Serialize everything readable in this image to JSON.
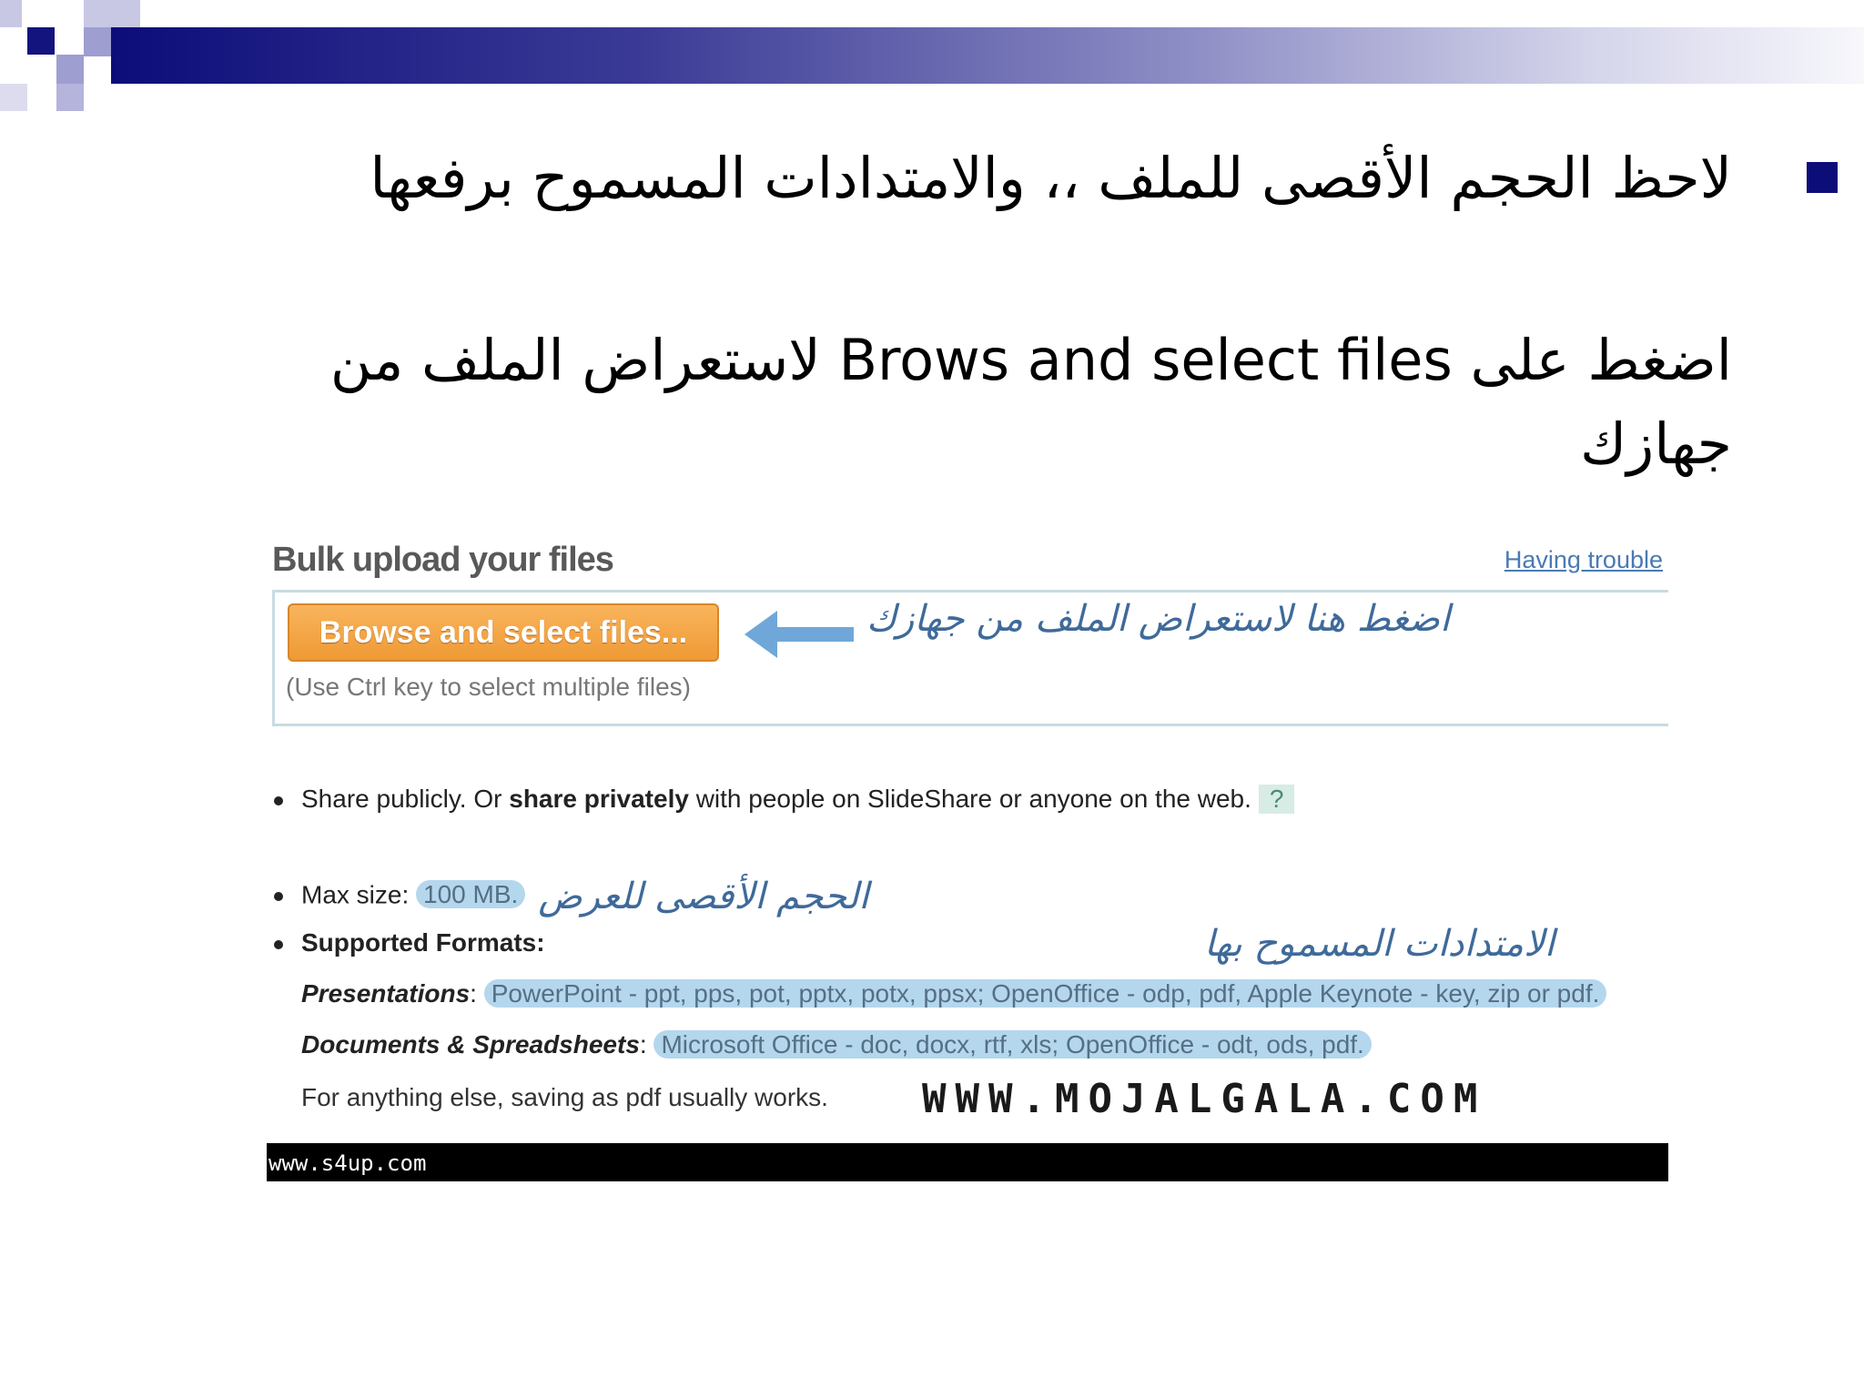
{
  "slide": {
    "line1": "لاحظ الحجم الأقصى للملف ،، والامتدادات المسموح برفعها",
    "line2": "اضغط على Brows and select files لاستعراض الملف من جهازك"
  },
  "upload_panel": {
    "title": "Bulk upload your files",
    "trouble_link": "Having trouble",
    "browse_button": "Browse and select files...",
    "browse_note": "اضغط هنا لاستعراض الملف من جهازك",
    "ctrl_hint": "(Use Ctrl key to select multiple files)"
  },
  "info": {
    "share_pre": "Share publicly. Or ",
    "share_bold": "share privately",
    "share_post": " with people on SlideShare or anyone on the web.",
    "help_badge": "?",
    "max_label": "Max size: ",
    "max_value": "100 MB.",
    "max_note": "الحجم الأقصى للعرض",
    "formats_label": "Supported Formats:",
    "formats_note": "الامتدادات المسموح بها",
    "pres_label": "Presentations",
    "pres_value": "PowerPoint - ppt, pps, pot, pptx, potx, ppsx; OpenOffice - odp, pdf, Apple Keynote - key, zip or pdf.",
    "docs_label": "Documents & Spreadsheets",
    "docs_value": "Microsoft Office - doc, docx, rtf, xls; OpenOffice - odt, ods, pdf.",
    "else_text": "For anything else, saving as pdf usually works.",
    "watermark": "WWW.MOJALGALA.COM",
    "footer_url": "www.s4up.com"
  },
  "colors": {
    "header_dark": "#0d0d7a",
    "button_orange": "#ef9a35",
    "highlight_blue": "#b4d7ee",
    "link_blue": "#4a7ab3"
  }
}
